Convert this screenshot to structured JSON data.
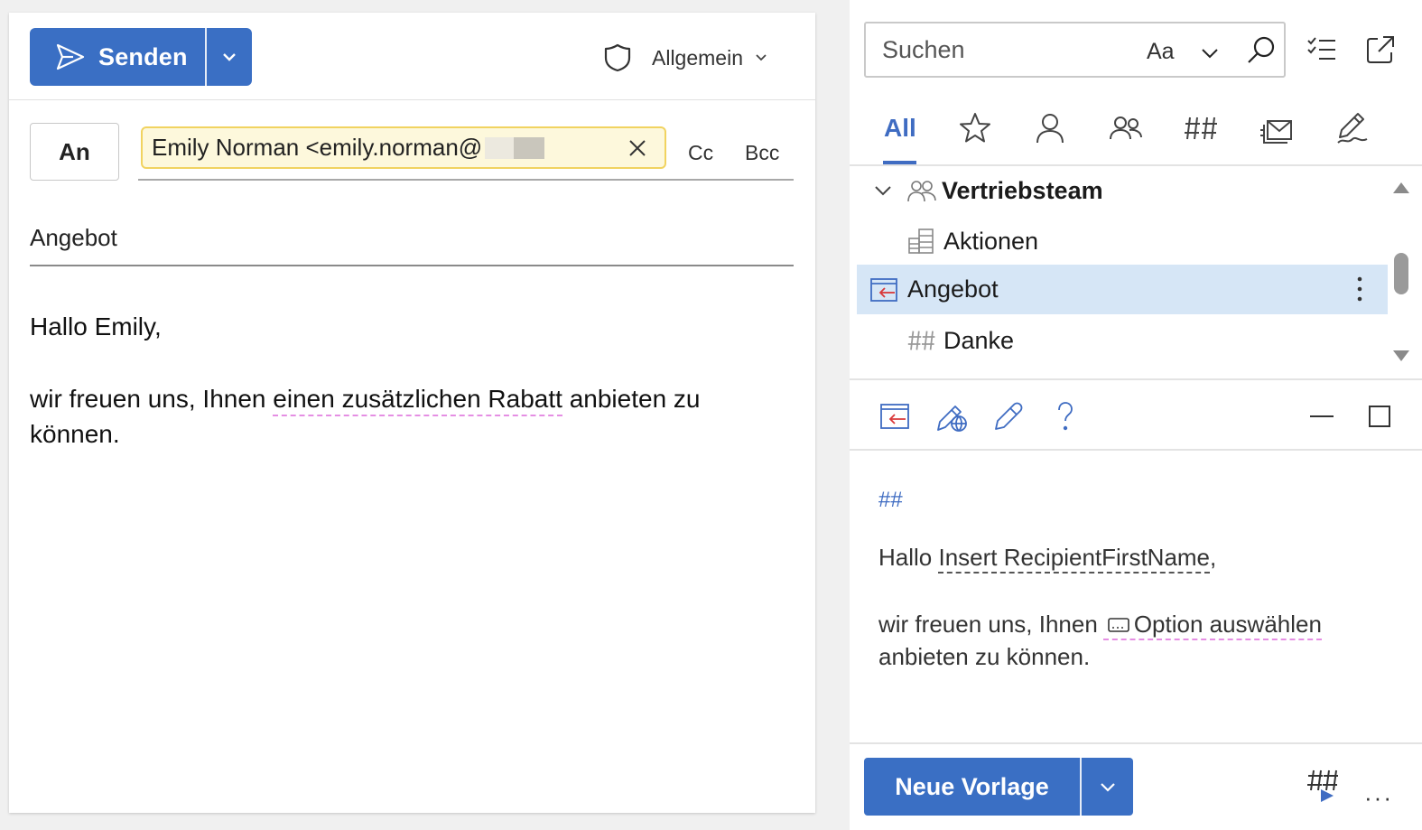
{
  "colors": {
    "accent": "#3a6fc4",
    "tab_active": "#3f6cc2",
    "chip_bg": "#fdf8dc",
    "chip_border": "#f1d360",
    "selected_row": "#d6e6f6",
    "spell_underline": "#e58ee3"
  },
  "compose": {
    "toolbar": {
      "send_label": "Senden",
      "send_icon": "send-icon",
      "send_dropdown_icon": "chevron-down-icon",
      "sensitivity_icon": "shield-icon",
      "sensitivity_label": "Allgemein"
    },
    "recipients": {
      "to_label": "An",
      "chip_text": "Emily Norman <emily.norman@",
      "cc_label": "Cc",
      "bcc_label": "Bcc"
    },
    "subject": "Angebot",
    "body": {
      "greeting": "Hallo Emily,",
      "para_pre": "wir freuen uns, Ihnen ",
      "para_marked": "einen zusätzlichen Rabatt",
      "para_post": " anbieten zu können."
    }
  },
  "pane": {
    "search": {
      "placeholder": "Suchen",
      "match_case_label": "Aa"
    },
    "tabs": {
      "all_label": "All",
      "icons": [
        "star-icon",
        "person-icon",
        "people-icon",
        "hash-icon",
        "mail-stack-icon",
        "pen-edit-icon"
      ]
    },
    "tree": {
      "items": [
        {
          "label": "Vertriebsteam",
          "icon": "people-icon",
          "expanded": true
        },
        {
          "label": "Aktionen",
          "icon": "table-icon"
        },
        {
          "label": "Angebot",
          "icon": "insert-template-icon",
          "selected": true
        },
        {
          "label": "Danke",
          "icon": "hash-icon"
        }
      ]
    },
    "preview": {
      "hash": "##",
      "line1_pre": "Hallo ",
      "line1_token": "Insert RecipientFirstName",
      "line1_post": ",",
      "line2_pre": "wir freuen uns, Ihnen",
      "line2_option": "Option auswählen",
      "line3": "anbieten zu können."
    },
    "footer": {
      "new_template_label": "Neue Vorlage"
    }
  }
}
